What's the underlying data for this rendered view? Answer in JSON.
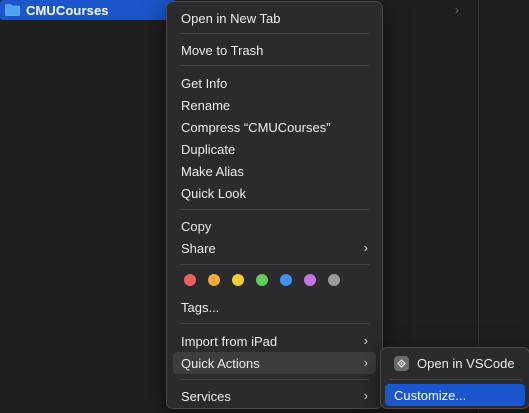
{
  "finder": {
    "selected_item": "CMUCourses",
    "folder_color": "#4aa3f0"
  },
  "menu": {
    "open_in_new_tab": "Open in New Tab",
    "move_to_trash": "Move to Trash",
    "get_info": "Get Info",
    "rename": "Rename",
    "compress": "Compress “CMUCourses”",
    "duplicate": "Duplicate",
    "make_alias": "Make Alias",
    "quick_look": "Quick Look",
    "copy": "Copy",
    "share": "Share",
    "tags": "Tags...",
    "import_from_ipad": "Import from iPad",
    "quick_actions": "Quick Actions",
    "services": "Services",
    "tag_colors": [
      {
        "name": "red",
        "hex": "#f2605c"
      },
      {
        "name": "orange",
        "hex": "#f7a93a"
      },
      {
        "name": "yellow",
        "hex": "#f4cf3a"
      },
      {
        "name": "green",
        "hex": "#5ccc5b"
      },
      {
        "name": "blue",
        "hex": "#3b94f5"
      },
      {
        "name": "purple",
        "hex": "#c374e8"
      },
      {
        "name": "gray",
        "hex": "#9b9b9e"
      }
    ]
  },
  "submenu": {
    "open_in_vscode": "Open in VSCode",
    "customize": "Customize...",
    "highlight_color": "#1b56cc"
  }
}
